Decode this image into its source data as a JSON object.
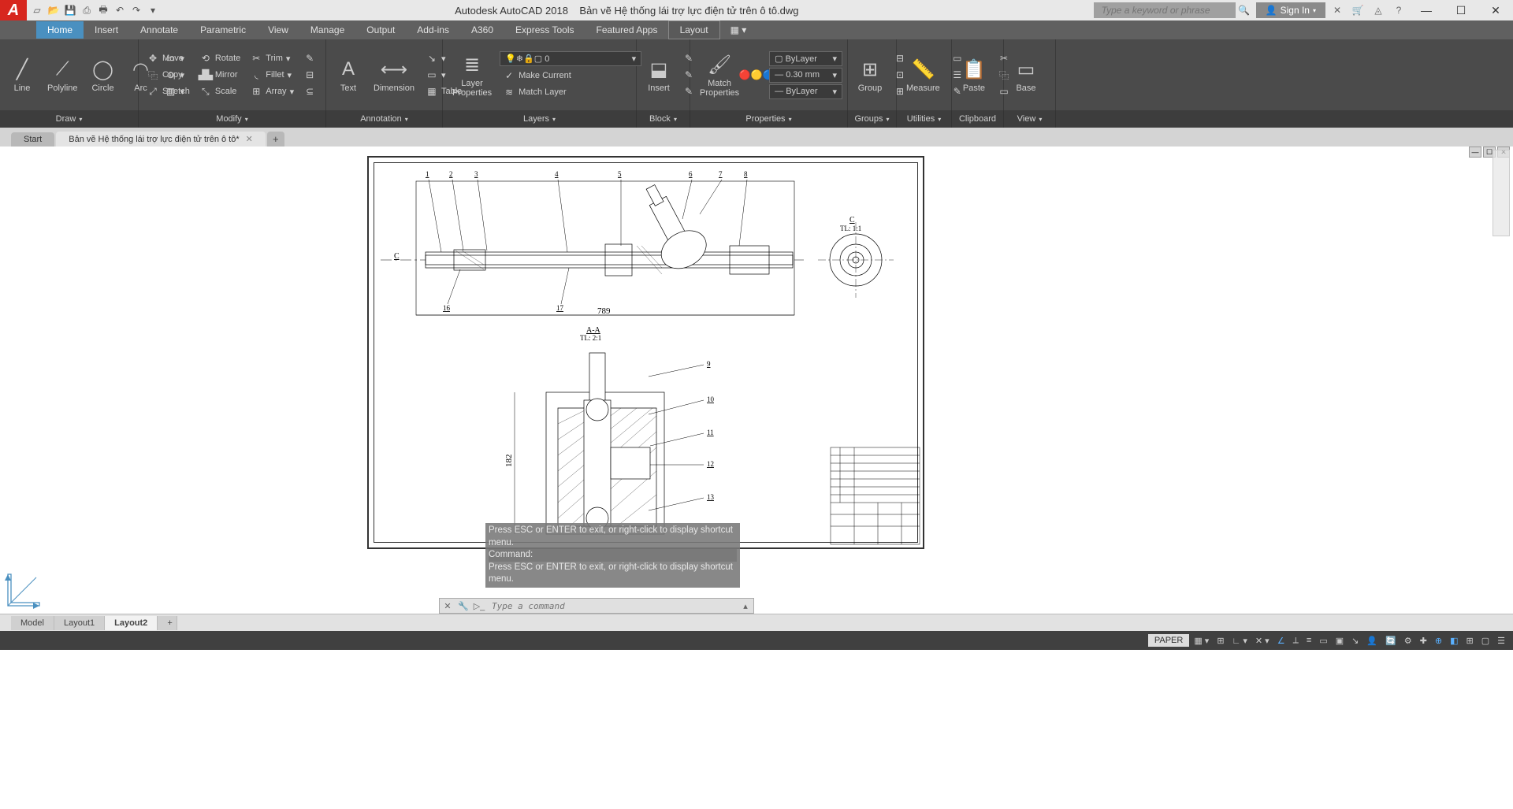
{
  "app": {
    "logo": "A",
    "title_vendor": "Autodesk AutoCAD 2018",
    "title_file": "Bản vẽ Hệ thống lái trợ lực điện tử trên ô tô.dwg",
    "search_placeholder": "Type a keyword or phrase",
    "signin": "Sign In"
  },
  "menu": {
    "items": [
      "Home",
      "Insert",
      "Annotate",
      "Parametric",
      "View",
      "Manage",
      "Output",
      "Add-ins",
      "A360",
      "Express Tools",
      "Featured Apps",
      "Layout"
    ],
    "active": "Home",
    "highlighted": "Layout"
  },
  "ribbon": {
    "draw": {
      "line": "Line",
      "polyline": "Polyline",
      "circle": "Circle",
      "arc": "Arc"
    },
    "modify": {
      "move": "Move",
      "copy": "Copy",
      "stretch": "Stretch",
      "rotate": "Rotate",
      "mirror": "Mirror",
      "scale": "Scale",
      "trim": "Trim",
      "fillet": "Fillet",
      "array": "Array"
    },
    "annotation": {
      "text": "Text",
      "dimension": "Dimension",
      "table": "Table"
    },
    "layers": {
      "props": "Layer\nProperties",
      "current": "0",
      "make_current": "Make Current",
      "match": "Match Layer"
    },
    "block": {
      "insert": "Insert"
    },
    "properties": {
      "match": "Match\nProperties",
      "layer": "ByLayer",
      "lw": "0.30 mm",
      "lt": "ByLayer"
    },
    "groups": {
      "group": "Group"
    },
    "utilities": {
      "measure": "Measure"
    },
    "clipboard": {
      "paste": "Paste"
    },
    "view": {
      "base": "Base"
    },
    "labels": [
      "Draw",
      "Modify",
      "Annotation",
      "Layers",
      "Block",
      "Properties",
      "Groups",
      "Utilities",
      "Clipboard",
      "View"
    ],
    "label_widths": [
      176,
      238,
      148,
      246,
      68,
      200,
      62,
      70,
      66,
      66
    ]
  },
  "filetabs": {
    "tabs": [
      "Start",
      "Bản vẽ Hệ thống lái trợ lực điện tử trên ô tô*"
    ],
    "active": 1
  },
  "drawing": {
    "section_top": "A-A",
    "scale_top": "TL: 2:1",
    "section_c": "C",
    "scale_c": "TL: 1:1",
    "dim_h": "789",
    "dim_v": "182",
    "callouts_top": [
      "1",
      "2",
      "3",
      "4",
      "5",
      "6",
      "7",
      "8"
    ],
    "callouts_bl": [
      "16",
      "17"
    ],
    "callouts_right": [
      "9",
      "10",
      "11",
      "12",
      "13"
    ],
    "c_left": "C",
    "c_right": "C"
  },
  "cmd": {
    "hist1": "Press ESC or ENTER to exit, or right-click to display shortcut menu.",
    "hist2": "Command:",
    "hist3": "Press ESC or ENTER to exit, or right-click to display shortcut menu.",
    "placeholder": "Type a command"
  },
  "layouttabs": {
    "tabs": [
      "Model",
      "Layout1",
      "Layout2"
    ],
    "active": 2
  },
  "status": {
    "paper": "PAPER"
  }
}
